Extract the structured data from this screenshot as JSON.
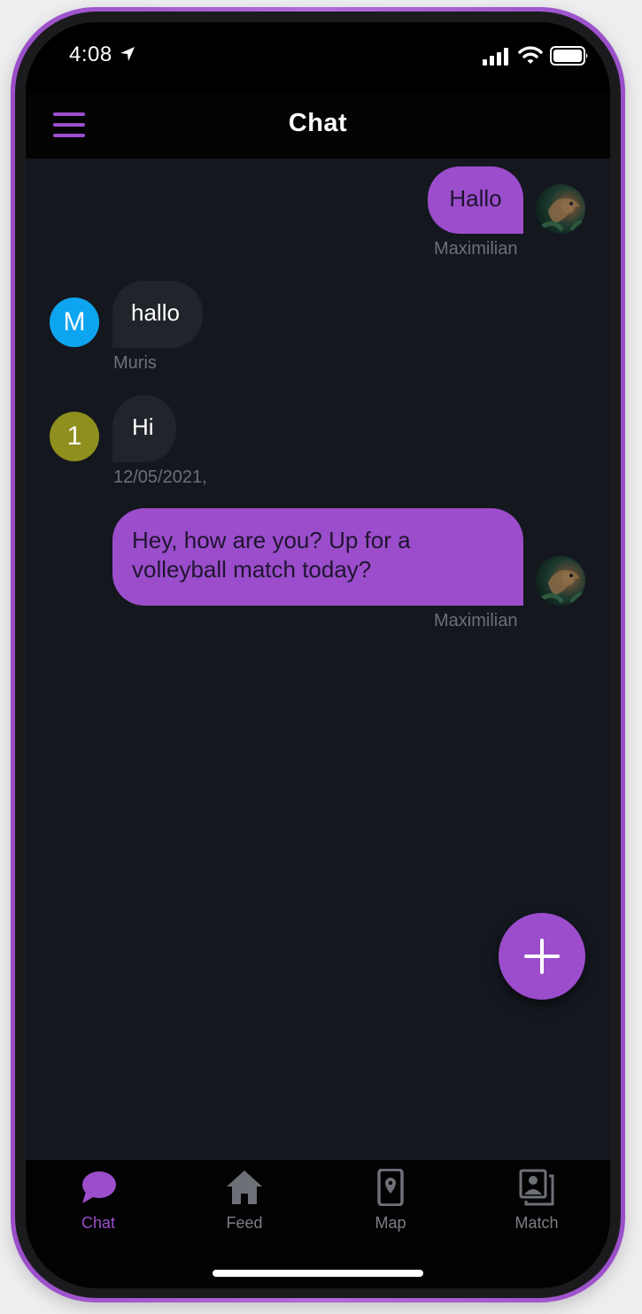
{
  "status_bar": {
    "time": "4:08"
  },
  "header": {
    "title": "Chat"
  },
  "messages": [
    {
      "text": "Hallo",
      "meta": "Maximilian",
      "direction": "outgoing"
    },
    {
      "text": "hallo",
      "meta": "Muris",
      "direction": "incoming",
      "avatar_letter": "M"
    },
    {
      "text": "Hi",
      "meta": "12/05/2021,",
      "direction": "incoming",
      "avatar_letter": "1"
    },
    {
      "text": "Hey, how are you? Up for a volleyball match today?",
      "meta": "Maximilian",
      "direction": "outgoing"
    }
  ],
  "nav": [
    {
      "label": "Chat",
      "icon": "chat-bubble-icon",
      "active": true
    },
    {
      "label": "Feed",
      "icon": "home-icon",
      "active": false
    },
    {
      "label": "Map",
      "icon": "map-pin-icon",
      "active": false
    },
    {
      "label": "Match",
      "icon": "photos-icon",
      "active": false
    }
  ],
  "colors": {
    "accent": "#9b4dcb",
    "background": "#15171f",
    "incoming_bubble": "#22242c",
    "avatar_m": "#0ea5f0",
    "avatar_1": "#8f8f1e"
  }
}
